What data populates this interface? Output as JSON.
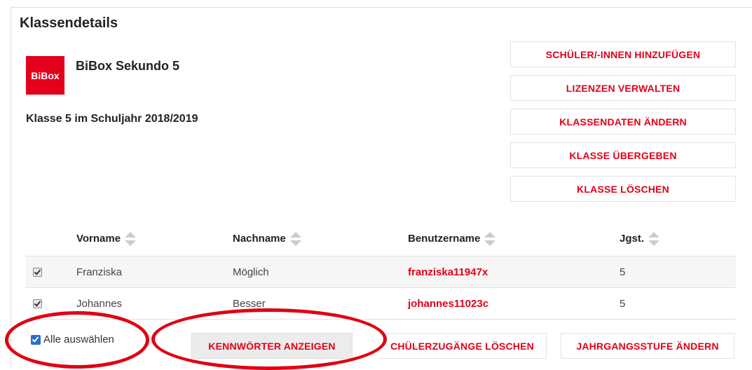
{
  "header": {
    "title": "Klassendetails"
  },
  "product": {
    "logo_text": "BiBox",
    "name": "BiBox Sekundo 5"
  },
  "class_info": "Klasse 5 im Schuljahr 2018/2019",
  "actions": [
    {
      "label": "SCHÜLER/-INNEN HINZUFÜGEN"
    },
    {
      "label": "LIZENZEN VERWALTEN"
    },
    {
      "label": "KLASSENDATEN ÄNDERN"
    },
    {
      "label": "KLASSE ÜBERGEBEN"
    },
    {
      "label": "KLASSE LÖSCHEN"
    }
  ],
  "table": {
    "columns": [
      "Vorname",
      "Nachname",
      "Benutzername",
      "Jgst."
    ],
    "rows": [
      {
        "checked": true,
        "vorname": "Franziska",
        "nachname": "Möglich",
        "benutzername": "franziska11947x",
        "jgst": "5"
      },
      {
        "checked": true,
        "vorname": "Johannes",
        "nachname": "Besser",
        "benutzername": "johannes11023c",
        "jgst": "5"
      }
    ]
  },
  "bottom": {
    "select_all_label": "Alle auswählen",
    "select_all_checked": true,
    "show_passwords": "KENNWÖRTER ANZEIGEN",
    "delete_access": "CHÜLERZUGÄNGE LÖSCHEN",
    "change_grade": "JAHRGANGSSTUFE ÄNDERN"
  },
  "colors": {
    "accent": "#e2001a",
    "annotation": "#e00010"
  }
}
